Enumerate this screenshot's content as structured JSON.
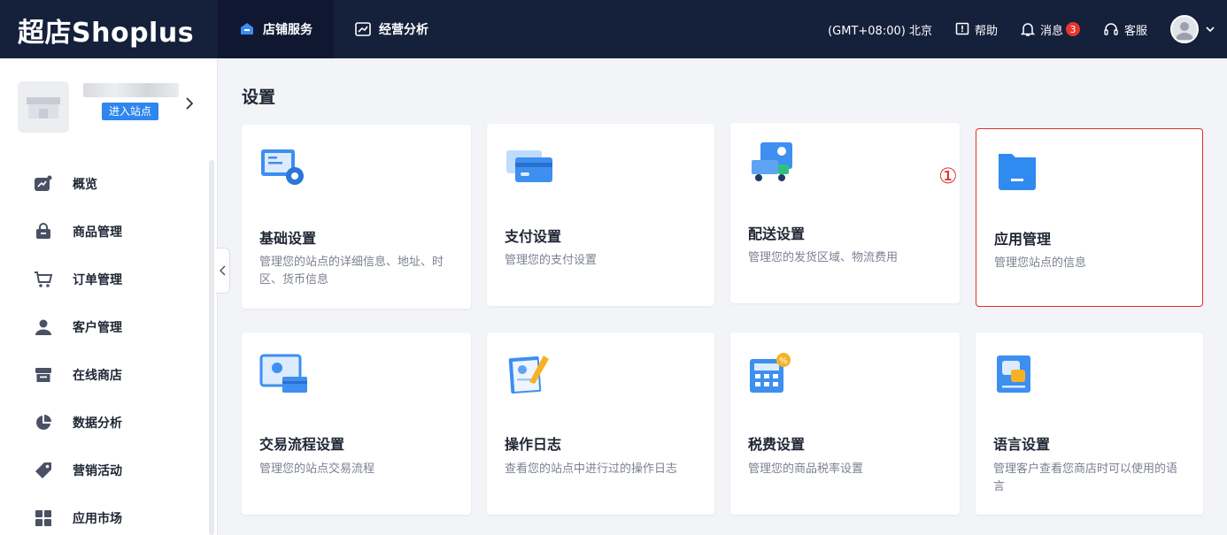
{
  "brand": {
    "name": "超店Shoplus"
  },
  "topnav": [
    {
      "label": "店铺服务",
      "icon": "store-service-icon",
      "active": true
    },
    {
      "label": "经营分析",
      "icon": "analytics-chart-icon",
      "active": false
    }
  ],
  "topright": {
    "timezone": "(GMT+08:00) 北京",
    "help": "帮助",
    "messages": "消息",
    "messages_count": "3",
    "support": "客服"
  },
  "store": {
    "enter_label": "进入站点"
  },
  "sidebar": {
    "items": [
      {
        "label": "概览",
        "icon": "overview-icon"
      },
      {
        "label": "商品管理",
        "icon": "product-bag-icon"
      },
      {
        "label": "订单管理",
        "icon": "cart-icon"
      },
      {
        "label": "客户管理",
        "icon": "user-icon"
      },
      {
        "label": "在线商店",
        "icon": "storefront-icon"
      },
      {
        "label": "数据分析",
        "icon": "pie-chart-icon"
      },
      {
        "label": "营销活动",
        "icon": "tag-icon"
      },
      {
        "label": "应用市场",
        "icon": "apps-grid-icon"
      }
    ]
  },
  "main": {
    "title": "设置",
    "marker": "①",
    "cards": [
      {
        "title": "基础设置",
        "desc": "管理您的站点的详细信息、地址、时区、货币信息",
        "icon": "basic-settings-icon"
      },
      {
        "title": "支付设置",
        "desc": "管理您的支付设置",
        "icon": "payment-card-icon"
      },
      {
        "title": "配送设置",
        "desc": "管理您的发货区域、物流费用",
        "icon": "delivery-truck-icon"
      },
      {
        "title": "应用管理",
        "desc": "管理您站点的信息",
        "icon": "app-folder-icon"
      },
      {
        "title": "交易流程设置",
        "desc": "管理您的站点交易流程",
        "icon": "transaction-flow-icon"
      },
      {
        "title": "操作日志",
        "desc": "查看您的站点中进行过的操作日志",
        "icon": "operation-log-icon"
      },
      {
        "title": "税费设置",
        "desc": "管理您的商品税率设置",
        "icon": "tax-calculator-icon"
      },
      {
        "title": "语言设置",
        "desc": "管理客户查看您商店时可以使用的语言",
        "icon": "language-icon"
      }
    ]
  },
  "colors": {
    "topbar": "#15203b",
    "accent": "#2f86ee",
    "highlight": "#e0312b",
    "badge": "#e8352e"
  }
}
